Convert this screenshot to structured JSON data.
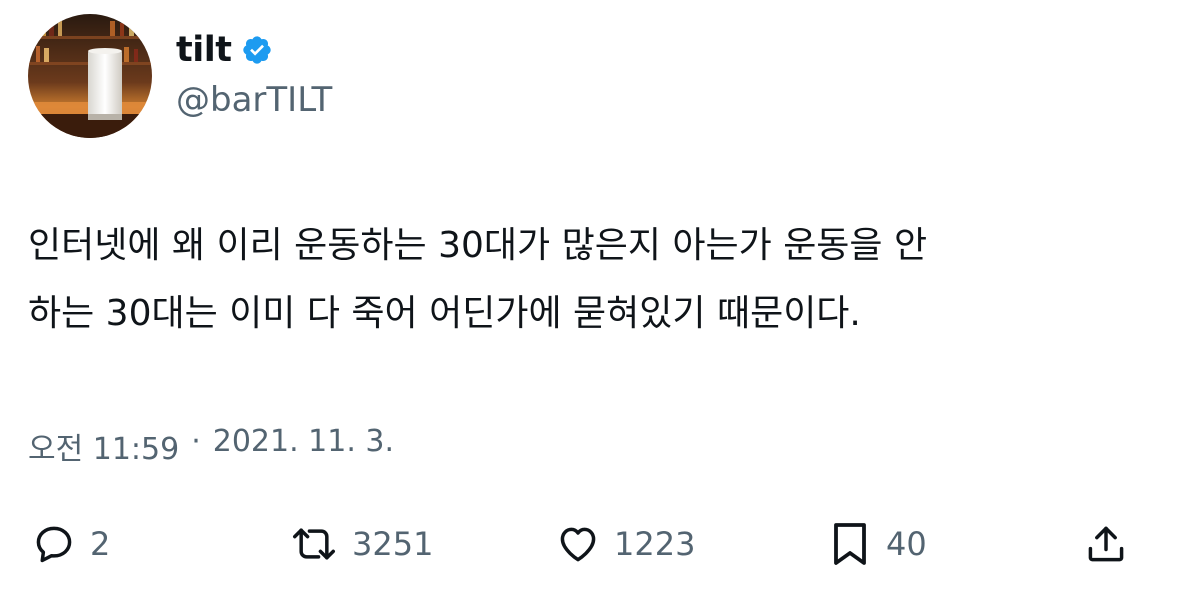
{
  "author": {
    "display_name": "tilt",
    "handle": "@barTILT",
    "verified": true
  },
  "tweet": {
    "text_lines": [
      "인터넷에 왜 이리 운동하는 30대가 많은지 아는가 운동을 안",
      "하는 30대는 이미 다 죽어 어딘가에 묻혀있기 때문이다."
    ],
    "time": "오전 11:59",
    "separator": "·",
    "date": "2021. 11. 3."
  },
  "actions": {
    "reply_count": "2",
    "retweet_count": "3251",
    "like_count": "1223",
    "bookmark_count": "40"
  },
  "icons": {
    "reply": "speech-bubble-icon",
    "retweet": "retweet-arrows-icon",
    "like": "heart-outline-icon",
    "bookmark": "bookmark-outline-icon",
    "share": "share-upload-icon",
    "verified": "verified-badge-icon"
  },
  "colors": {
    "text_primary": "#0f1419",
    "text_secondary": "#536471",
    "verified_blue": "#1d9bf0"
  }
}
